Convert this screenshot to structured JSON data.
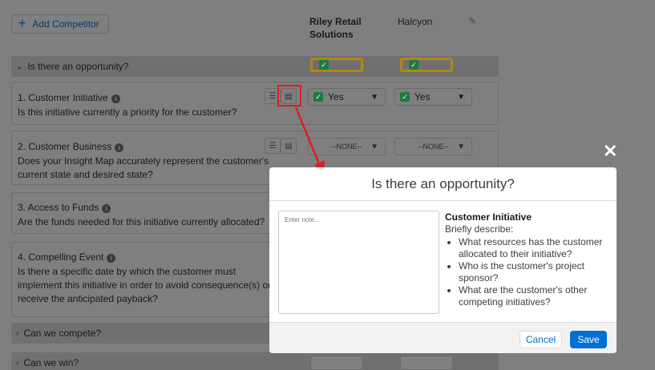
{
  "toolbar": {
    "add_label": "Add Competitor",
    "add_icon": "plus-icon"
  },
  "columns": {
    "c1": "Riley Retail",
    "c1b": "Solutions",
    "c2": "Halcyon"
  },
  "sections": {
    "opportunity": "Is there an opportunity?",
    "compete": "Can we compete?",
    "win": "Can we win?"
  },
  "questions": [
    {
      "title": "1. Customer Initiative",
      "desc": "Is this initiative currently a priority for the customer?",
      "v1": "Yes",
      "v2": "Yes"
    },
    {
      "title": "2. Customer Business",
      "desc1": "Does your Insight Map accurately represent the customer's",
      "desc2": "current state and desired state?",
      "v1": "--NONE--",
      "v2": "--NONE--"
    },
    {
      "title": "3. Access to Funds",
      "desc": "Are the funds needed for this initiative currently allocated?"
    },
    {
      "title": "4. Compelling Event",
      "desc1": "Is there a specific date by which the customer must",
      "desc2": "implement this initiative in order to avoid consequence(s) or",
      "desc3": "receive the anticipated payback?"
    }
  ],
  "modal": {
    "title": "Is there an opportunity?",
    "note_placeholder": "Enter note...",
    "guide_title": "Customer Initiative",
    "guide_intro": "Briefly describe:",
    "bullets": [
      "What resources has the customer allocated to their initiative?",
      "Who is the customer's project sponsor?",
      "What are the customer's other competing initiatives?"
    ],
    "cancel": "Cancel",
    "save": "Save",
    "close_glyph": "✕"
  },
  "colors": {
    "accent": "#0070d2",
    "highlight": "#d9211e",
    "overlay": "#7f7f7f",
    "gold": "#b08810"
  }
}
